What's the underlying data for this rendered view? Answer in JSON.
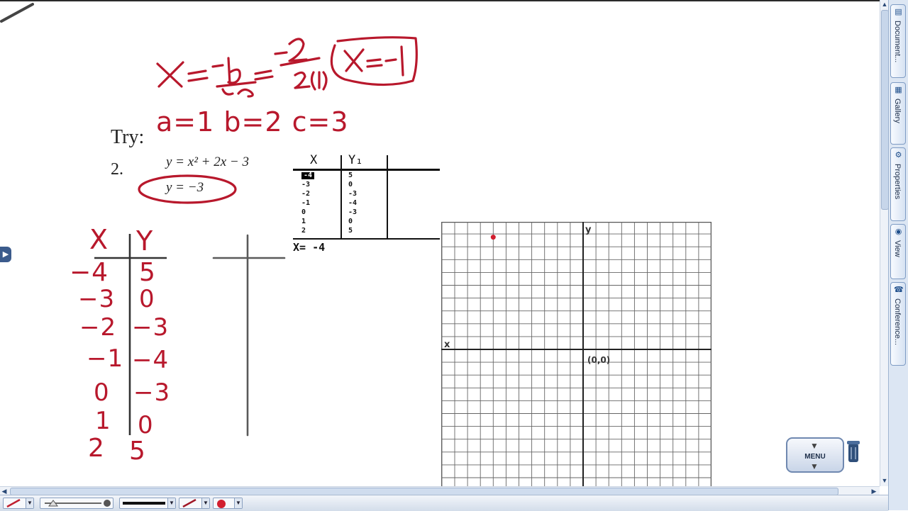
{
  "canvas": {
    "try_label": "Try:",
    "problem_number": "2.",
    "equation": "y = x² + 2x − 3",
    "answer": "y = −3"
  },
  "handwriting": {
    "vertex_formula": "x = −b/2a = −2/2(1)",
    "vertex_result": "x = −1",
    "coefficients": "a=1  b=2  c=3",
    "table_headers": [
      "X",
      "Y"
    ],
    "table_x": [
      "−4",
      "−3",
      "−2",
      "−1",
      "0",
      "1",
      "2"
    ],
    "table_y": [
      "5",
      "0",
      "−3",
      "−4",
      "−3",
      "0",
      "5"
    ]
  },
  "calculator_table": {
    "headers": [
      "X",
      "Y₁"
    ],
    "x_values": [
      "-4",
      "-3",
      "-2",
      "-1",
      "0",
      "1",
      "2"
    ],
    "y_values": [
      "5",
      "0",
      "-3",
      "-4",
      "-3",
      "0",
      "5"
    ],
    "selected": "-4",
    "footer": "X= -4"
  },
  "graph": {
    "x_axis_label": "x",
    "y_axis_label": "y",
    "origin_label": "(0,0)",
    "point_color": "#d21f2f",
    "plotted_point": {
      "x": -4,
      "y": 5
    }
  },
  "sidebar": {
    "tabs": [
      {
        "label": "Document...",
        "icon": "document-icon"
      },
      {
        "label": "Gallery",
        "icon": "gallery-icon"
      },
      {
        "label": "Properties",
        "icon": "properties-icon"
      },
      {
        "label": "View",
        "icon": "view-icon"
      },
      {
        "label": "Conference...",
        "icon": "conference-icon"
      }
    ]
  },
  "menu_button": {
    "label": "MENU"
  },
  "colors": {
    "ink": "#b8182c",
    "sidebar": "#dce6f3",
    "accent": "#3b5b8c"
  }
}
